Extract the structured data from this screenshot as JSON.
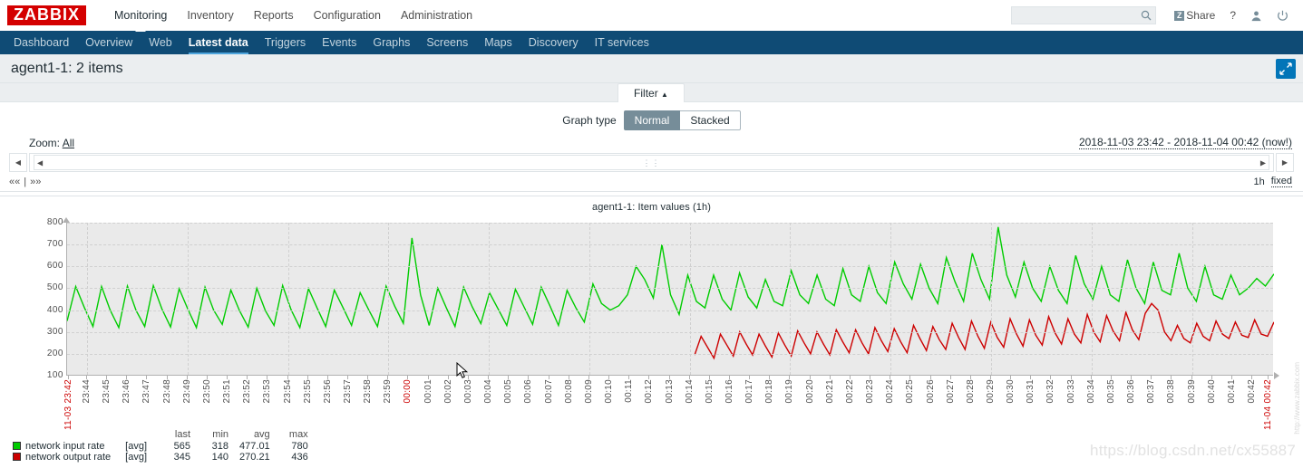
{
  "topnav": {
    "logo": "ZABBIX",
    "items": [
      {
        "label": "Monitoring",
        "selected": true
      },
      {
        "label": "Inventory",
        "selected": false
      },
      {
        "label": "Reports",
        "selected": false
      },
      {
        "label": "Configuration",
        "selected": false
      },
      {
        "label": "Administration",
        "selected": false
      }
    ],
    "search_placeholder": "",
    "search_value": "",
    "share_label": "Share",
    "share_badge": "Z",
    "help_label": "?"
  },
  "subnav": {
    "items": [
      {
        "label": "Dashboard",
        "selected": false
      },
      {
        "label": "Overview",
        "selected": false
      },
      {
        "label": "Web",
        "selected": false
      },
      {
        "label": "Latest data",
        "selected": true
      },
      {
        "label": "Triggers",
        "selected": false
      },
      {
        "label": "Events",
        "selected": false
      },
      {
        "label": "Graphs",
        "selected": false
      },
      {
        "label": "Screens",
        "selected": false
      },
      {
        "label": "Maps",
        "selected": false
      },
      {
        "label": "Discovery",
        "selected": false
      },
      {
        "label": "IT services",
        "selected": false
      }
    ]
  },
  "header": {
    "title": "agent1-1: 2 items"
  },
  "filter": {
    "tab_label": "Filter",
    "tab_caret": "▲",
    "graph_type_label": "Graph type",
    "graph_type_options": [
      "Normal",
      "Stacked"
    ],
    "graph_type_selected": "Normal"
  },
  "timeselector": {
    "zoom_label": "Zoom:",
    "zoom_value": "All",
    "range_text": "2018-11-03 23:42 - 2018-11-04 00:42 (now!)",
    "prev_all": "««",
    "next_all": "»»",
    "separator": "|",
    "period_label": "1h",
    "fixed_label": "fixed"
  },
  "chart_data": {
    "type": "line",
    "title": "agent1-1: Item values (1h)",
    "xlabel": "",
    "ylabel": "",
    "ylim": [
      100,
      800
    ],
    "yticks": [
      800,
      700,
      600,
      500,
      400,
      300,
      200,
      100
    ],
    "grid": true,
    "legend_position": "bottom-left",
    "x_start_label": "11-03 23:42",
    "x_end_label": "11-04 00:42",
    "x_midnight_label": "00:00",
    "xticks": [
      "23:44",
      "23:45",
      "23:46",
      "23:47",
      "23:48",
      "23:49",
      "23:50",
      "23:51",
      "23:52",
      "23:53",
      "23:54",
      "23:55",
      "23:56",
      "23:57",
      "23:58",
      "23:59",
      "00:00",
      "00:01",
      "00:02",
      "00:03",
      "00:04",
      "00:05",
      "00:06",
      "00:07",
      "00:08",
      "00:09",
      "00:10",
      "00:11",
      "00:12",
      "00:13",
      "00:14",
      "00:15",
      "00:16",
      "00:17",
      "00:18",
      "00:19",
      "00:20",
      "00:21",
      "00:22",
      "00:23",
      "00:24",
      "00:25",
      "00:26",
      "00:27",
      "00:28",
      "00:29",
      "00:30",
      "00:31",
      "00:32",
      "00:33",
      "00:34",
      "00:35",
      "00:36",
      "00:37",
      "00:38",
      "00:39",
      "00:40",
      "00:41",
      "00:42"
    ],
    "watermark": "http://www.zabbix.com",
    "legend_headers": [
      "last",
      "min",
      "avg",
      "max"
    ],
    "series": [
      {
        "name": "network input rate",
        "aggregation": "[avg]",
        "color": "#00CC00",
        "last": "565",
        "min": "318",
        "avg": "477.01",
        "max": "780",
        "values": [
          350,
          508,
          412,
          325,
          508,
          400,
          320,
          510,
          398,
          325,
          512,
          405,
          323,
          498,
          405,
          320,
          505,
          400,
          335,
          492,
          398,
          322,
          500,
          397,
          330,
          512,
          400,
          320,
          498,
          410,
          325,
          492,
          412,
          330,
          480,
          400,
          325,
          510,
          418,
          340,
          730,
          470,
          330,
          500,
          410,
          325,
          505,
          415,
          338,
          480,
          405,
          330,
          495,
          415,
          335,
          505,
          420,
          330,
          490,
          412,
          345,
          520,
          430,
          400,
          420,
          470,
          600,
          540,
          455,
          700,
          470,
          380,
          560,
          440,
          410,
          560,
          450,
          400,
          570,
          460,
          410,
          540,
          440,
          420,
          580,
          470,
          430,
          560,
          450,
          420,
          590,
          470,
          440,
          600,
          480,
          430,
          620,
          520,
          450,
          610,
          500,
          430,
          640,
          530,
          440,
          660,
          540,
          450,
          780,
          560,
          460,
          620,
          500,
          440,
          600,
          490,
          430,
          650,
          520,
          450,
          600,
          470,
          440,
          630,
          500,
          430,
          620,
          490,
          470,
          660,
          500,
          440,
          600,
          470,
          450,
          560,
          470,
          500,
          545,
          510,
          565
        ]
      },
      {
        "name": "network output rate",
        "aggregation": "[avg]",
        "color": "#CC0000",
        "last": "345",
        "min": "140",
        "avg": "270.21",
        "max": "436",
        "values": [
          195,
          280,
          230,
          180,
          290,
          240,
          190,
          300,
          245,
          195,
          290,
          235,
          185,
          295,
          240,
          190,
          305,
          250,
          200,
          300,
          245,
          195,
          310,
          255,
          205,
          310,
          250,
          200,
          320,
          260,
          210,
          315,
          255,
          205,
          330,
          270,
          215,
          325,
          265,
          220,
          340,
          275,
          220,
          350,
          280,
          225,
          345,
          275,
          230,
          360,
          290,
          235,
          355,
          285,
          240,
          370,
          295,
          245,
          360,
          290,
          250,
          380,
          300,
          255,
          375,
          305,
          260,
          390,
          310,
          265,
          385,
          430,
          400,
          300,
          260,
          330,
          270,
          250,
          340,
          280,
          260,
          350,
          290,
          270,
          345,
          285,
          275,
          355,
          290,
          280,
          345
        ]
      }
    ]
  },
  "watermarks": {
    "blog": "https://blog.csdn.net/cx55887"
  }
}
